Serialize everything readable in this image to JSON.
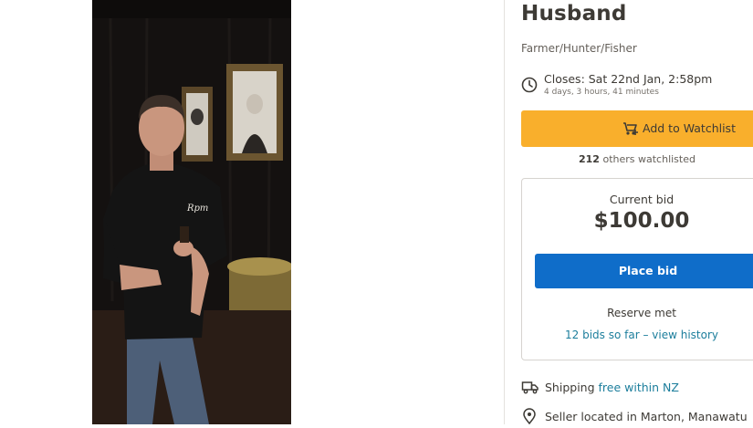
{
  "listing": {
    "title": "Husband",
    "subtitle": "Farmer/Hunter/Fisher"
  },
  "closing": {
    "icon": "clock-icon",
    "label": "Closes: Sat 22nd Jan, 2:58pm",
    "countdown": "4 days, 3 hours, 41 minutes"
  },
  "watchlist": {
    "icon": "watchlist-add-icon",
    "button_label": "Add to Watchlist",
    "count": "212",
    "count_suffix": " others watchlisted",
    "button_color": "#f9af2c"
  },
  "bid": {
    "label": "Current bid",
    "amount": "$100.00",
    "button_label": "Place bid",
    "button_color": "#0f6dc9",
    "reserve_status": "Reserve met",
    "history_link": "12 bids so far – view history"
  },
  "shipping": {
    "icon": "truck-icon",
    "label": "Shipping ",
    "value": "free within NZ"
  },
  "seller": {
    "icon": "location-pin-icon",
    "label": "Seller located in Marton, Manawatu"
  },
  "photo": {
    "description_icon": "listing-photo",
    "shirt_print": "Rpm"
  }
}
